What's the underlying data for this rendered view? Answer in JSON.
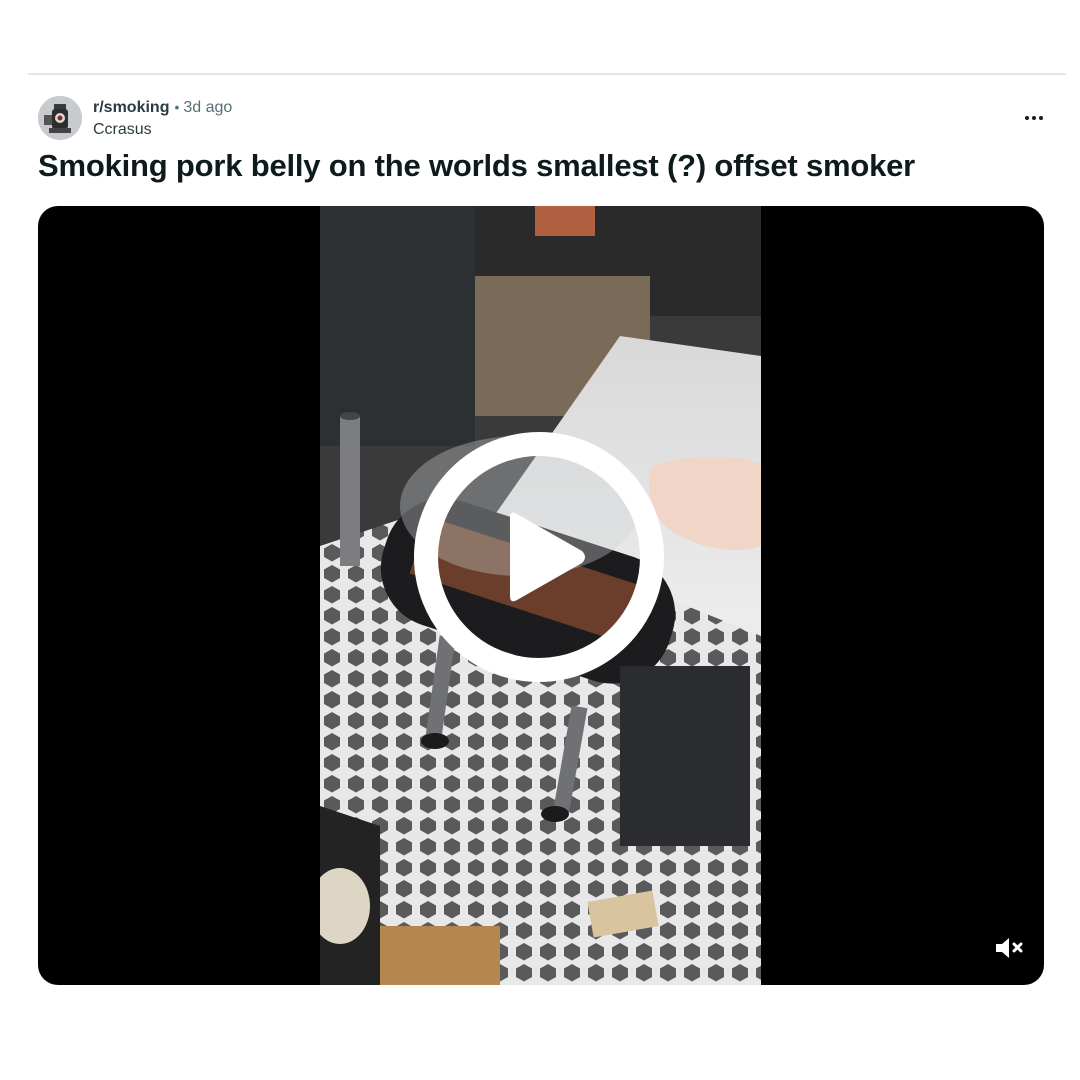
{
  "post": {
    "subreddit": "r/smoking",
    "separator": "•",
    "time_ago": "3d ago",
    "author": "Ccrasus",
    "title": "Smoking pork belly on the worlds smallest (?) offset smoker"
  },
  "icons": {
    "more": "more-options-icon",
    "play": "play-icon",
    "mute": "volume-muted-icon",
    "avatar": "subreddit-avatar-icon"
  },
  "colors": {
    "background": "#ffffff",
    "title": "#0f1a1c",
    "meta": "#576f76",
    "video_background": "#000000",
    "play_overlay": "#ffffff"
  }
}
